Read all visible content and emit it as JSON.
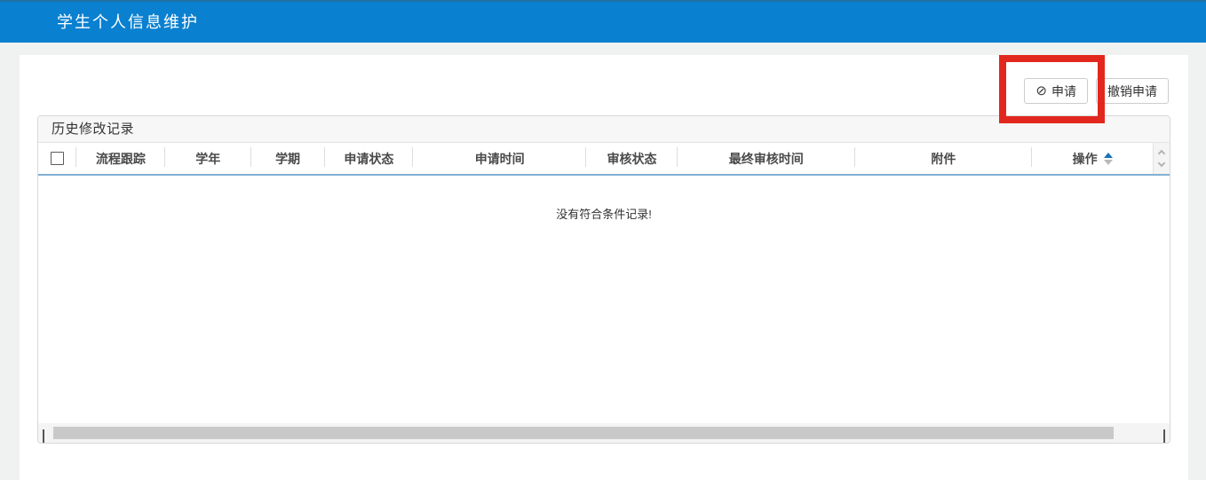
{
  "app_header": {
    "title": "学生个人信息维护"
  },
  "toolbar": {
    "apply_button": {
      "label": "申请",
      "icon": "ban-icon"
    },
    "revoke_button": {
      "label": "撤销申请"
    }
  },
  "grid": {
    "title": "历史修改记录",
    "columns": [
      "流程跟踪",
      "学年",
      "学期",
      "申请状态",
      "申请时间",
      "审核状态",
      "最终审核时间",
      "附件",
      "操作"
    ],
    "sorted_column": "操作",
    "empty_message": "没有符合条件记录!"
  },
  "annotation": {
    "type": "highlight-box",
    "color": "#e2281e"
  },
  "colors": {
    "header_bar_bg": "#0a80d0",
    "grid_header_underline": "#82b1d3",
    "sort_active_arrow": "#1a72b8",
    "page_bg": "#f0f1f1"
  }
}
